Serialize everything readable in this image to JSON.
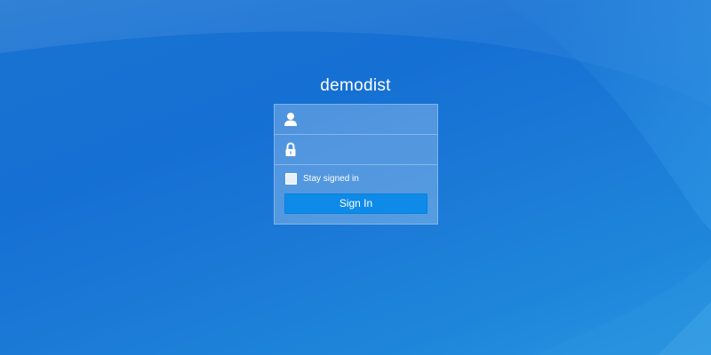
{
  "server_name": "demodist",
  "login": {
    "username": {
      "value": "",
      "placeholder": "",
      "icon": "user-icon"
    },
    "password": {
      "value": "",
      "placeholder": "",
      "icon": "lock-icon"
    },
    "remember_label": "Stay signed in",
    "remember_checked": false,
    "sign_in_label": "Sign In"
  },
  "colors": {
    "background": "#1a73d1",
    "button": "#0e8ae8",
    "text": "#ffffff"
  }
}
